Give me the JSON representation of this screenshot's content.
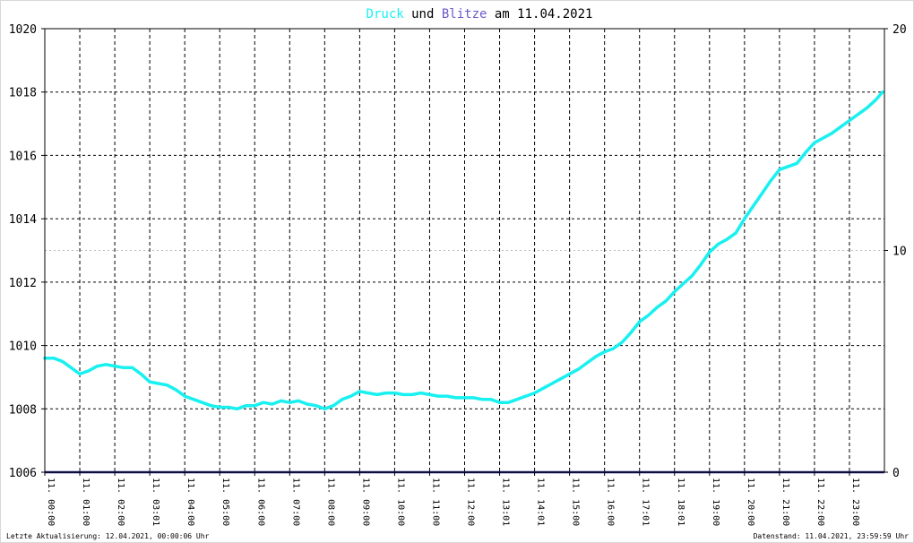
{
  "title": {
    "part1": "Druck",
    "part2": " und ",
    "part3": "Blitze",
    "part4": " am 11.04.2021"
  },
  "colors": {
    "druck": "#19f0f0",
    "blitze": "#6a5acd",
    "baseline": "#1a1a80",
    "grid": "#000000",
    "grid_mid": "#bbbbbb"
  },
  "footer": {
    "left": "Letzte Aktualisierung: 12.04.2021, 00:00:06 Uhr",
    "right": "Datenstand: 11.04.2021, 23:59:59 Uhr"
  },
  "chart_data": {
    "type": "line",
    "title": "Druck und Blitze am 11.04.2021",
    "x_tick_labels": [
      "11. 00:00",
      "11. 01:00",
      "11. 02:00",
      "11. 03:01",
      "11. 04:00",
      "11. 05:00",
      "11. 06:00",
      "11. 07:00",
      "11. 08:00",
      "11. 09:00",
      "11. 10:00",
      "11. 11:00",
      "11. 12:00",
      "11. 13:01",
      "11. 14:01",
      "11. 15:00",
      "11. 16:00",
      "11. 17:01",
      "11. 18:01",
      "11. 19:00",
      "11. 20:00",
      "11. 21:00",
      "11. 22:00",
      "11. 23:00"
    ],
    "xlim_hours": [
      0,
      24
    ],
    "y_left": {
      "ylim": [
        1006,
        1020
      ],
      "ticks": [
        1006,
        1008,
        1010,
        1012,
        1014,
        1016,
        1018,
        1020
      ]
    },
    "y_right": {
      "ylim": [
        0,
        20
      ],
      "ticks": [
        0,
        10,
        20
      ]
    },
    "grid": true,
    "series": [
      {
        "name": "Druck",
        "axis": "left",
        "x_hours": [
          0,
          0.25,
          0.5,
          0.75,
          1.0,
          1.25,
          1.5,
          1.75,
          2.0,
          2.25,
          2.5,
          2.75,
          3.0,
          3.25,
          3.5,
          3.75,
          4.0,
          4.25,
          4.5,
          4.75,
          5.0,
          5.25,
          5.5,
          5.75,
          6.0,
          6.25,
          6.5,
          6.75,
          7.0,
          7.25,
          7.5,
          7.75,
          8.0,
          8.25,
          8.5,
          8.75,
          9.0,
          9.25,
          9.5,
          9.75,
          10.0,
          10.25,
          10.5,
          10.75,
          11.0,
          11.25,
          11.5,
          11.75,
          12.0,
          12.25,
          12.5,
          12.75,
          13.0,
          13.25,
          13.5,
          13.75,
          14.0,
          14.25,
          14.5,
          14.75,
          15.0,
          15.25,
          15.5,
          15.75,
          16.0,
          16.25,
          16.5,
          16.75,
          17.0,
          17.25,
          17.5,
          17.75,
          18.0,
          18.25,
          18.5,
          18.75,
          19.0,
          19.25,
          19.5,
          19.75,
          20.0,
          20.25,
          20.5,
          20.75,
          21.0,
          21.25,
          21.5,
          21.75,
          22.0,
          22.25,
          22.5,
          22.75,
          23.0,
          23.25,
          23.5,
          23.75,
          23.95
        ],
        "values": [
          1009.6,
          1009.6,
          1009.5,
          1009.3,
          1009.1,
          1009.2,
          1009.35,
          1009.4,
          1009.35,
          1009.3,
          1009.3,
          1009.1,
          1008.85,
          1008.8,
          1008.75,
          1008.6,
          1008.4,
          1008.3,
          1008.2,
          1008.1,
          1008.05,
          1008.05,
          1008.0,
          1008.1,
          1008.1,
          1008.2,
          1008.15,
          1008.25,
          1008.2,
          1008.25,
          1008.15,
          1008.1,
          1008.0,
          1008.1,
          1008.3,
          1008.4,
          1008.55,
          1008.5,
          1008.45,
          1008.5,
          1008.5,
          1008.45,
          1008.45,
          1008.5,
          1008.45,
          1008.4,
          1008.4,
          1008.35,
          1008.35,
          1008.35,
          1008.3,
          1008.3,
          1008.2,
          1008.2,
          1008.3,
          1008.4,
          1008.5,
          1008.65,
          1008.8,
          1008.95,
          1009.1,
          1009.25,
          1009.45,
          1009.65,
          1009.8,
          1009.9,
          1010.1,
          1010.4,
          1010.75,
          1010.95,
          1011.2,
          1011.4,
          1011.7,
          1011.95,
          1012.2,
          1012.55,
          1012.95,
          1013.2,
          1013.35,
          1013.55,
          1014.0,
          1014.4,
          1014.8,
          1015.2,
          1015.55,
          1015.65,
          1015.75,
          1016.1,
          1016.4,
          1016.55,
          1016.7,
          1016.9,
          1017.1,
          1017.3,
          1017.5,
          1017.75,
          1018.0
        ]
      },
      {
        "name": "Blitze",
        "axis": "right",
        "x_hours": [
          0,
          24
        ],
        "values": [
          0,
          0
        ]
      }
    ]
  }
}
